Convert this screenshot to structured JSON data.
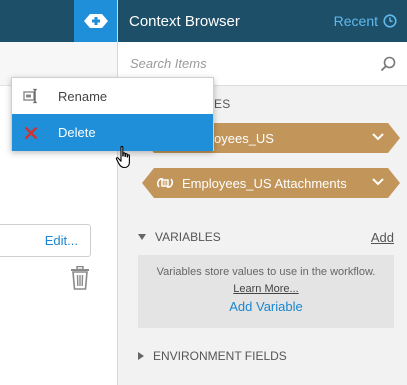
{
  "header": {
    "title": "Context Browser",
    "recent_label": "Recent",
    "add_icon": "plus-icon"
  },
  "search": {
    "placeholder": "Search Items"
  },
  "sections": {
    "partial_label": "ES",
    "chips": [
      {
        "label": "Employees_US",
        "partial_label": "oyees_US",
        "icon": "table-icon"
      },
      {
        "label": "Employees_US Attachments",
        "icon": "attachments-icon"
      }
    ]
  },
  "variables": {
    "title": "VARIABLES",
    "add_label": "Add",
    "description": "Variables store values to use in the workflow.",
    "learn_more": "Learn More...",
    "add_variable": "Add Variable"
  },
  "environment": {
    "title": "ENVIRONMENT FIELDS"
  },
  "left": {
    "edit_label": "Edit..."
  },
  "context_menu": {
    "items": [
      {
        "label": "Rename",
        "icon": "rename-icon"
      },
      {
        "label": "Delete",
        "icon": "delete-x-icon"
      }
    ]
  },
  "colors": {
    "header_bg": "#1d4f68",
    "accent_blue": "#1f8fd9",
    "chip_tan": "#c2955a",
    "delete_red": "#d0322d"
  }
}
